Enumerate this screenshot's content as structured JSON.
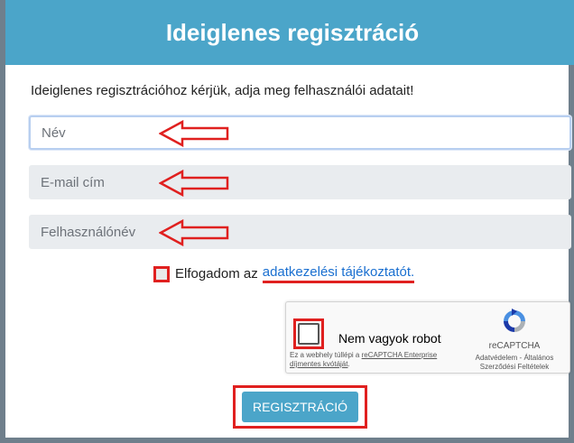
{
  "page": {
    "title": "Ideiglenes regisztráció",
    "intro": "Ideiglenes regisztrációhoz kérjük, adja meg felhasználói adatait!"
  },
  "form": {
    "name_placeholder": "Név",
    "email_placeholder": "E-mail cím",
    "username_placeholder": "Felhasználónév"
  },
  "consent": {
    "text": "Elfogadom az",
    "link": "adatkezelési tájékoztatót."
  },
  "captcha": {
    "label": "Nem vagyok robot",
    "fine_print_prefix": "Ez a webhely túllépi a ",
    "fine_print_link": "reCAPTCHA Enterprise díjmentes kvótáját",
    "fine_print_suffix": ".",
    "brand": "reCAPTCHA",
    "links_line1": "Adatvédelem - Általános",
    "links_line2": "Szerződési Feltételek"
  },
  "submit": {
    "label": "REGISZTRÁCIÓ"
  },
  "colors": {
    "header": "#4ba5c9",
    "highlight": "#e0201f",
    "link": "#1a6fd0"
  }
}
